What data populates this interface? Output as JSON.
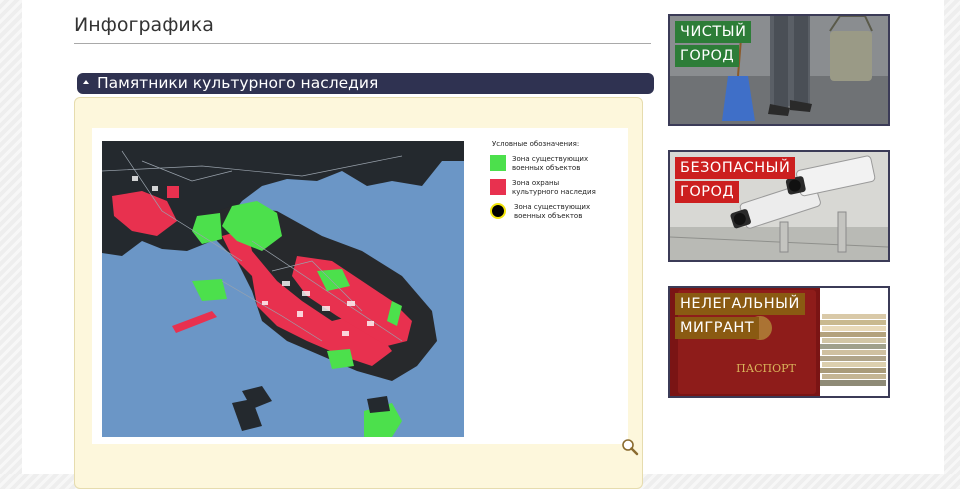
{
  "section": {
    "title": "Инфографика"
  },
  "accordion": {
    "label": "Памятники культурного наследия"
  },
  "map": {
    "legend": {
      "title": "Условные обозначения:",
      "items": [
        {
          "color": "#4ce04c",
          "label_line1": "Зона существующих",
          "label_line2": "военных объектов"
        },
        {
          "color": "#e8314f",
          "label_line1": "Зона охраны",
          "label_line2": "культурного наследия"
        },
        {
          "color": "#000000",
          "ring": "#f2e40c",
          "label_line1": "Зона существующих",
          "label_line2": "военных объектов"
        }
      ]
    }
  },
  "banners": [
    {
      "line1": "ЧИСТЫЙ",
      "line2": "ГОРОД",
      "label_color": "#2d7d38"
    },
    {
      "line1": "БЕЗОПАСНЫЙ",
      "line2": "ГОРОД",
      "label_color": "#cc1f1f"
    },
    {
      "line1": "НЕЛЕГАЛЬНЫЙ",
      "line2": "МИГРАНТ",
      "label_color": "#8a5a12",
      "passport_text": "ПАСПОРТ"
    }
  ]
}
